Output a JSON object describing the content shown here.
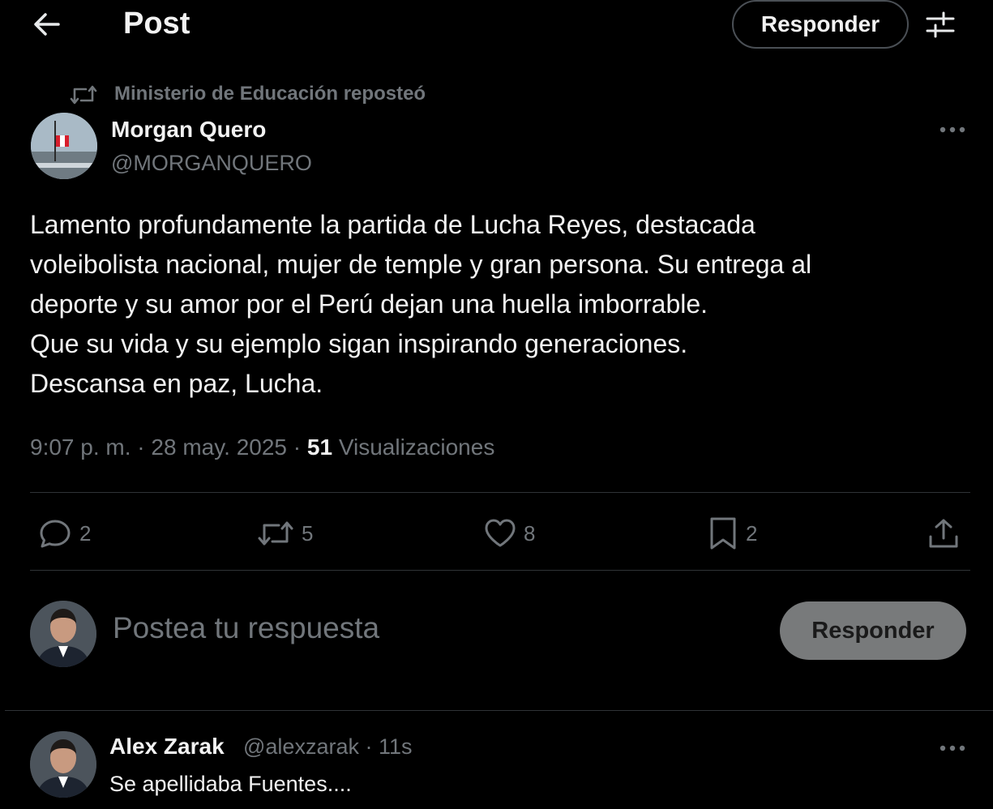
{
  "header": {
    "title": "Post",
    "reply_button": "Responder"
  },
  "repost": {
    "text": "Ministerio de Educación reposteó"
  },
  "post": {
    "author_name": "Morgan Quero",
    "author_handle": "@MORGANQUERO",
    "body_lines": [
      "Lamento profundamente la partida de Lucha Reyes, destacada",
      "voleibolista nacional, mujer de temple y gran persona. Su entrega al",
      "deporte y su amor por el Perú dejan una huella imborrable.",
      "Que su vida y su ejemplo sigan inspirando generaciones.",
      "Descansa en paz, Lucha."
    ],
    "time": "9:07 p. m.",
    "date": "28 may. 2025",
    "views_count": "51",
    "views_label": "Visualizaciones",
    "sep": "·"
  },
  "actions": {
    "replies": "2",
    "reposts": "5",
    "likes": "8",
    "bookmarks": "2"
  },
  "compose": {
    "placeholder": "Postea tu respuesta",
    "button": "Responder"
  },
  "reply": {
    "name": "Alex Zarak",
    "handle": "@alexzarak",
    "time": "11s",
    "text": "Se apellidaba Fuentes...."
  },
  "colors": {
    "background": "#000000",
    "text": "#e7e9ea",
    "muted": "#71767b",
    "divider": "#2f3336"
  },
  "icons": [
    "back-arrow-icon",
    "filters-icon",
    "repost-icon",
    "more-icon",
    "reply-icon",
    "like-icon",
    "bookmark-icon",
    "share-icon"
  ]
}
